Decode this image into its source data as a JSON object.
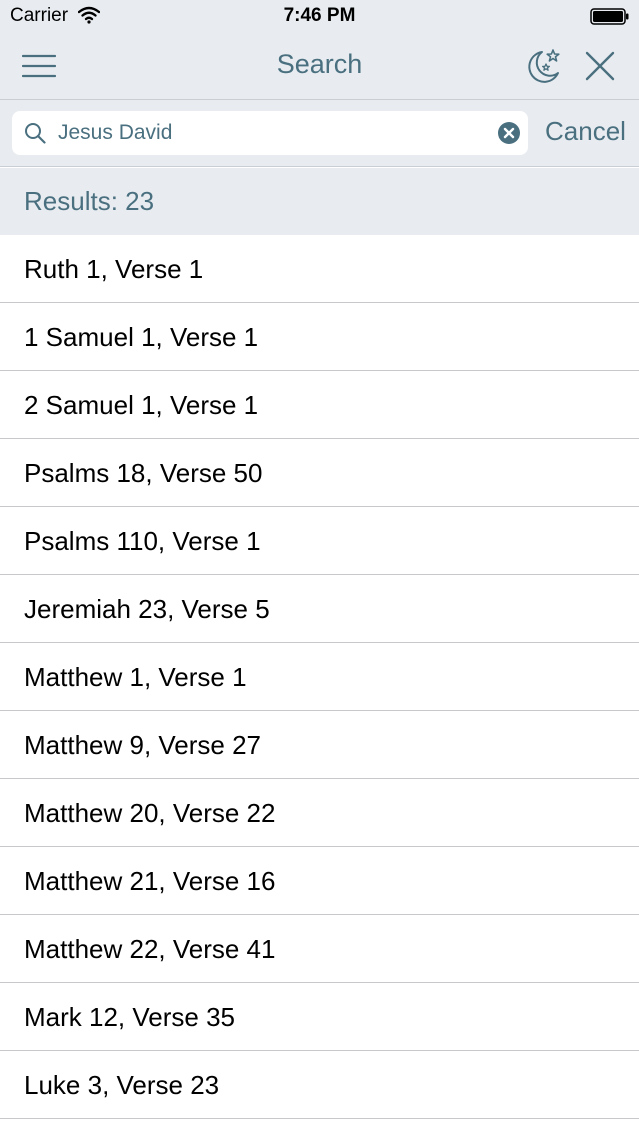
{
  "status_bar": {
    "carrier": "Carrier",
    "time": "7:46 PM"
  },
  "nav": {
    "title": "Search",
    "icons": [
      "menu-icon",
      "night-mode-icon",
      "close-icon"
    ]
  },
  "search": {
    "value": "Jesus David",
    "cancel_label": "Cancel"
  },
  "results": {
    "header": "Results: 23",
    "items": [
      "Ruth 1, Verse 1",
      "1 Samuel 1, Verse 1",
      "2 Samuel 1, Verse 1",
      "Psalms 18, Verse 50",
      "Psalms 110, Verse 1",
      "Jeremiah 23, Verse 5",
      "Matthew 1, Verse 1",
      "Matthew 9, Verse 27",
      "Matthew 20, Verse 22",
      "Matthew 21, Verse 16",
      "Matthew 22, Verse 41",
      "Mark 12, Verse 35",
      "Luke 3, Verse 23"
    ]
  },
  "colors": {
    "accent": "#4a7080",
    "bar_background": "#e8ecf0",
    "separator": "#c8c8cc"
  }
}
